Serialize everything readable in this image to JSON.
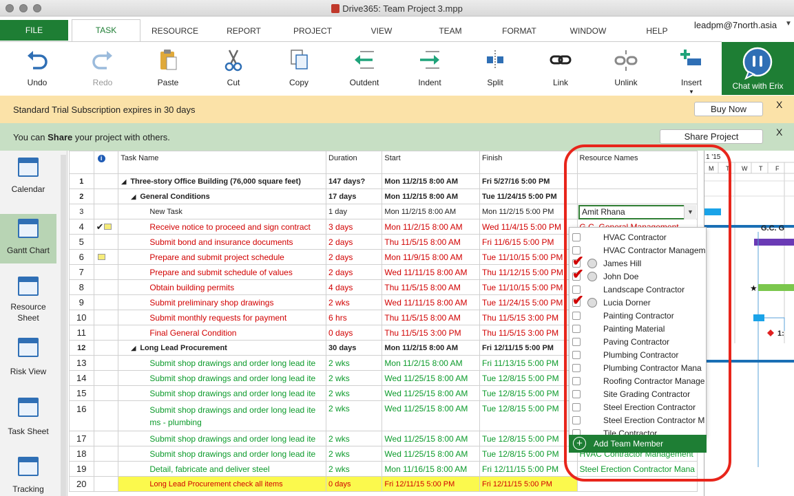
{
  "window": {
    "title": "Drive365: Team Project 3.mpp"
  },
  "tabs": [
    {
      "label": "FILE"
    },
    {
      "label": "TASK"
    },
    {
      "label": "RESOURCE"
    },
    {
      "label": "REPORT"
    },
    {
      "label": "PROJECT"
    },
    {
      "label": "VIEW"
    },
    {
      "label": "TEAM"
    },
    {
      "label": "FORMAT"
    },
    {
      "label": "WINDOW"
    },
    {
      "label": "HELP"
    }
  ],
  "user": {
    "email": "leadpm@7north.asia"
  },
  "ribbon": {
    "buttons": [
      {
        "label": "Undo",
        "icon": "undo-icon"
      },
      {
        "label": "Redo",
        "icon": "redo-icon"
      },
      {
        "label": "Paste",
        "icon": "paste-icon"
      },
      {
        "label": "Cut",
        "icon": "cut-icon"
      },
      {
        "label": "Copy",
        "icon": "copy-icon"
      },
      {
        "label": "Outdent",
        "icon": "outdent-icon"
      },
      {
        "label": "Indent",
        "icon": "indent-icon"
      },
      {
        "label": "Split",
        "icon": "split-icon"
      },
      {
        "label": "Link",
        "icon": "link-icon"
      },
      {
        "label": "Unlink",
        "icon": "unlink-icon"
      },
      {
        "label": "Insert",
        "icon": "insert-icon"
      }
    ],
    "chat_label": "Chat with Erix"
  },
  "banners": {
    "trial_text": "Standard Trial Subscription expires in 30 days",
    "buy_now": "Buy Now",
    "share_prefix": "You can ",
    "share_bold": "Share",
    "share_suffix": " your project with others.",
    "share_button": "Share Project",
    "close": "X"
  },
  "sidebar": [
    {
      "label": "Calendar"
    },
    {
      "label": "Gantt Chart"
    },
    {
      "label": "Resource Sheet"
    },
    {
      "label": "Risk View"
    },
    {
      "label": "Task Sheet"
    },
    {
      "label": "Tracking"
    }
  ],
  "grid": {
    "headers": {
      "info": "i",
      "task": "Task Name",
      "duration": "Duration",
      "start": "Start",
      "finish": "Finish",
      "resources": "Resource Names"
    },
    "rows": [
      {
        "n": "1",
        "name": "Three-story Office Building (76,000 square feet)",
        "dur": "147 days?",
        "start": "Mon 11/2/15 8:00 AM",
        "finish": "Fri 5/27/16 5:00 PM",
        "res": ""
      },
      {
        "n": "2",
        "name": "General Conditions",
        "dur": "17 days",
        "start": "Mon 11/2/15 8:00 AM",
        "finish": "Tue 11/24/15 5:00 PM",
        "res": ""
      },
      {
        "n": "3",
        "name": "New Task",
        "dur": "1 day",
        "start": "Mon 11/2/15 8:00 AM",
        "finish": "Mon 11/2/15 5:00 PM",
        "res": ""
      },
      {
        "n": "4",
        "name": "Receive notice to proceed and sign contract",
        "dur": "3 days",
        "start": "Mon 11/2/15 8:00 AM",
        "finish": "Wed 11/4/15 5:00 PM",
        "res": "G.C. General Management"
      },
      {
        "n": "5",
        "name": "Submit bond and insurance documents",
        "dur": "2 days",
        "start": "Thu 11/5/15 8:00 AM",
        "finish": "Fri 11/6/15 5:00 PM",
        "res": ""
      },
      {
        "n": "6",
        "name": "Prepare and submit project schedule",
        "dur": "2 days",
        "start": "Mon 11/9/15 8:00 AM",
        "finish": "Tue 11/10/15 5:00 PM",
        "res": ""
      },
      {
        "n": "7",
        "name": "Prepare and submit schedule of values",
        "dur": "2 days",
        "start": "Wed 11/11/15 8:00 AM",
        "finish": "Thu 11/12/15 5:00 PM",
        "res": ""
      },
      {
        "n": "8",
        "name": "Obtain building permits",
        "dur": "4 days",
        "start": "Thu 11/5/15 8:00 AM",
        "finish": "Tue 11/10/15 5:00 PM",
        "res": ""
      },
      {
        "n": "9",
        "name": "Submit preliminary shop drawings",
        "dur": "2 wks",
        "start": "Wed 11/11/15 8:00 AM",
        "finish": "Tue 11/24/15 5:00 PM",
        "res": ""
      },
      {
        "n": "10",
        "name": "Submit monthly requests for payment",
        "dur": "6 hrs",
        "start": "Thu 11/5/15 8:00 AM",
        "finish": "Thu 11/5/15 3:00 PM",
        "res": ""
      },
      {
        "n": "11",
        "name": "Final General Condition",
        "dur": "0 days",
        "start": "Thu 11/5/15 3:00 PM",
        "finish": "Thu 11/5/15 3:00 PM",
        "res": ""
      },
      {
        "n": "12",
        "name": "Long Lead Procurement",
        "dur": "30 days",
        "start": "Mon 11/2/15 8:00 AM",
        "finish": "Fri 12/11/15 5:00 PM",
        "res": ""
      },
      {
        "n": "13",
        "name": "Submit shop drawings and order long lead ite",
        "dur": "2 wks",
        "start": "Mon 11/2/15 8:00 AM",
        "finish": "Fri 11/13/15 5:00 PM",
        "res": ""
      },
      {
        "n": "14",
        "name": "Submit shop drawings and order long lead ite",
        "dur": "2 wks",
        "start": "Wed 11/25/15 8:00 AM",
        "finish": "Tue 12/8/15 5:00 PM",
        "res": ""
      },
      {
        "n": "15",
        "name": "Submit shop drawings and order long lead ite",
        "dur": "2 wks",
        "start": "Wed 11/25/15 8:00 AM",
        "finish": "Tue 12/8/15 5:00 PM",
        "res": ""
      },
      {
        "n": "16",
        "name": "Submit shop drawings and order long lead ite ms - plumbing",
        "dur": "2 wks",
        "start": "Wed 11/25/15 8:00 AM",
        "finish": "Tue 12/8/15 5:00 PM",
        "res": ""
      },
      {
        "n": "17",
        "name": "Submit shop drawings and order long lead ite",
        "dur": "2 wks",
        "start": "Wed 11/25/15 8:00 AM",
        "finish": "Tue 12/8/15 5:00 PM",
        "res": ""
      },
      {
        "n": "18",
        "name": "Submit shop drawings and order long lead ite",
        "dur": "2 wks",
        "start": "Wed 11/25/15 8:00 AM",
        "finish": "Tue 12/8/15 5:00 PM",
        "res": "HVAC Contractor Management"
      },
      {
        "n": "19",
        "name": "Detail, fabricate and deliver steel",
        "dur": "2 wks",
        "start": "Mon 11/16/15 8:00 AM",
        "finish": "Fri 12/11/15 5:00 PM",
        "res": "Steel Erection Contractor Mana"
      },
      {
        "n": "20",
        "name": "Long Lead Procurement check all items",
        "dur": "0 days",
        "start": "Fri 12/11/15 5:00 PM",
        "finish": "Fri 12/11/15 5:00 PM",
        "res": ""
      }
    ]
  },
  "gantt": {
    "period": "1 '15",
    "days": [
      "M",
      "T",
      "W",
      "T",
      "F"
    ],
    "labels": [
      "G.C. G",
      "1:"
    ]
  },
  "resource_dropdown": {
    "value": "Amit Rhana",
    "items": [
      {
        "label": "HVAC Contractor",
        "checked": false,
        "person": false
      },
      {
        "label": "HVAC Contractor Managem",
        "checked": false,
        "person": false
      },
      {
        "label": "James Hill",
        "checked": true,
        "person": true
      },
      {
        "label": "John Doe",
        "checked": true,
        "person": true
      },
      {
        "label": "Landscape Contractor",
        "checked": false,
        "person": false
      },
      {
        "label": "Lucia Dorner",
        "checked": true,
        "person": true
      },
      {
        "label": "Painting Contractor",
        "checked": false,
        "person": false
      },
      {
        "label": "Painting Material",
        "checked": false,
        "person": false
      },
      {
        "label": "Paving Contractor",
        "checked": false,
        "person": false
      },
      {
        "label": "Plumbing Contractor",
        "checked": false,
        "person": false
      },
      {
        "label": "Plumbing Contractor Mana",
        "checked": false,
        "person": false
      },
      {
        "label": "Roofing Contractor Manage",
        "checked": false,
        "person": false
      },
      {
        "label": "Site Grading Contractor",
        "checked": false,
        "person": false
      },
      {
        "label": "Steel Erection Contractor",
        "checked": false,
        "person": false
      },
      {
        "label": "Steel Erection Contractor M",
        "checked": false,
        "person": false
      },
      {
        "label": "Tile Contractor",
        "checked": false,
        "person": false
      }
    ],
    "add_label": "Add Team Member"
  },
  "colors": {
    "accent": "#1e7e34",
    "task_red": "#d10000",
    "task_green": "#0b9a2a",
    "highlight": "#e8251b"
  }
}
